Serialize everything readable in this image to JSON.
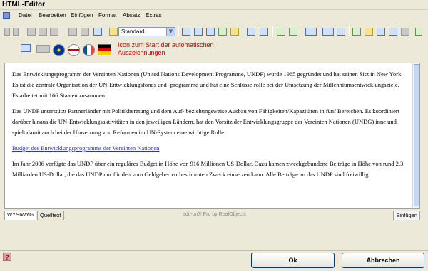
{
  "window": {
    "title": "HTML-Editor"
  },
  "menu": [
    "Datei",
    "Bearbeiten",
    "Einfügen",
    "Format",
    "Absatz",
    "Extras"
  ],
  "toolbar": {
    "style_select_value": "Standard"
  },
  "tooltip": {
    "text": "Icon zum Start der automatischen Auszeichnungen"
  },
  "editor": {
    "paragraphs": [
      "Das Entwicklungsprogramm der Vereinten Nationen (United Nations Development Programme, UNDP) wurde 1965 gegründet und hat seinen Sitz in New York. Es ist die zentrale Organisation der UN-Entwicklungsfonds und -programme und hat eine Schlüsselrolle bei der Umsetzung der Millenniumsentwicklungsziele. Es arbeitet mit 166 Staaten zusammen.",
      "Das UNDP unterstützt Partnerländer mit Politikberatung und dem Auf- beziehungsweise Ausbau von Fähigkeiten/Kapazitäten in fünf Bereichen. Es koordiniert darüber hinaus die UN-Entwicklungsaktivitäten in den jeweiligen Ländern, hat den Vorsitz der Entwicklungsgruppe der Vereinten Nationen (UNDG) inne und spielt damit auch bei der Umsetzung von Reformen im UN-System eine wichtige Rolle.",
      "Im Jahr 2006 verfügte das UNDP über ein reguläres Budget in Höhe von 916 Millionen US-Dollar. Dazu kamen zweckgebundene Beiträge in Höhe von rund 2,3 Milliarden US-Dollar, die das UNDP nur für den vom Geldgeber vorbestimmten Zweck einsetzen kann. Alle Beiträge an das UNDP sind freiwillig."
    ],
    "link_text": "Budget des Entwicklungsprogramms der Vereinten Nationen"
  },
  "tabs": [
    "WYSIWYG",
    "Quelltext"
  ],
  "footer_text": "edit-on® Pro by RealObjects",
  "mode_indicator": "Einfügen",
  "buttons": {
    "ok": "Ok",
    "cancel": "Abbrechen"
  }
}
